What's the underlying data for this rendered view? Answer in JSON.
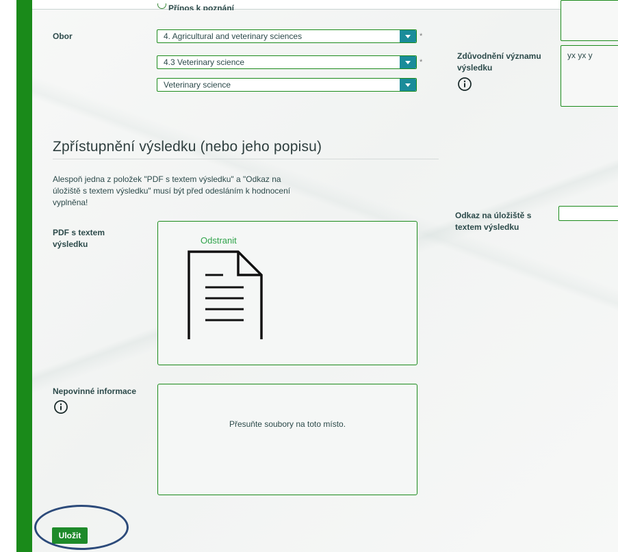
{
  "top_radio": {
    "label": "Přínos k poznání"
  },
  "obor": {
    "label": "Obor",
    "field": "4. Agricultural and veterinary sciences",
    "subfield": "4.3 Veterinary science",
    "detail": "Veterinary science",
    "required_mark": "*"
  },
  "justification": {
    "label_line1": "Zdůvodnění významu",
    "label_line2": "výsledku",
    "value": "yx yx y"
  },
  "section": {
    "title": "Zpřístupnění výsledku (nebo jeho popisu)",
    "note_line1": "Alespoň jedna z položek \"PDF s textem výsledku\" a \"Odkaz na",
    "note_line2": "úložiště s textem výsledku\" musí být před odesláním k hodnocení",
    "note_line3": "vyplněna!"
  },
  "pdf": {
    "label_line1": "PDF s textem",
    "label_line2": "výsledku",
    "remove_label": "Odstranit"
  },
  "repo_link": {
    "label_line1": "Odkaz na úložiště s",
    "label_line2": "textem výsledku",
    "value": ""
  },
  "optional": {
    "label": "Nepovinné informace",
    "drop_hint": "Přesuňte soubory na toto místo."
  },
  "save_label": "Uložit",
  "colors": {
    "accent_green": "#1a8a1a",
    "select_arrow": "#1a8c9a",
    "highlight": "#2c4a7a"
  },
  "icons": [
    "info-icon",
    "document-icon",
    "chevron-down-icon"
  ]
}
